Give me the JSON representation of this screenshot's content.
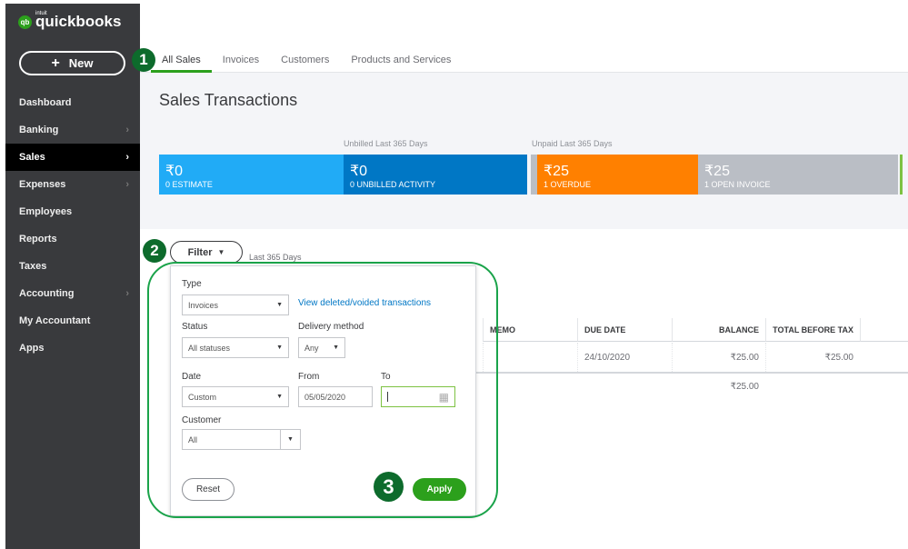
{
  "brand": {
    "logo_small": "intuit",
    "logo": "quickbooks",
    "logo_mark": "qb"
  },
  "sidebar": {
    "new_label": "New",
    "items": [
      {
        "label": "Dashboard",
        "chevron": false
      },
      {
        "label": "Banking",
        "chevron": true
      },
      {
        "label": "Sales",
        "chevron": true,
        "active": true
      },
      {
        "label": "Expenses",
        "chevron": true
      },
      {
        "label": "Employees",
        "chevron": false
      },
      {
        "label": "Reports",
        "chevron": false
      },
      {
        "label": "Taxes",
        "chevron": false
      },
      {
        "label": "Accounting",
        "chevron": true
      },
      {
        "label": "My Accountant",
        "chevron": false
      },
      {
        "label": "Apps",
        "chevron": false
      }
    ]
  },
  "tabs": [
    "All Sales",
    "Invoices",
    "Customers",
    "Products and Services"
  ],
  "page_title": "Sales Transactions",
  "summary": {
    "unbilled_caption": "Unbilled Last 365 Days",
    "unpaid_caption": "Unpaid Last 365 Days",
    "cards": [
      {
        "amount": "₹0",
        "label": "0 ESTIMATE",
        "color": "#21abf6"
      },
      {
        "amount": "₹0",
        "label": "0 UNBILLED ACTIVITY",
        "color": "#0077c5"
      },
      {
        "amount": "₹25",
        "label": "1 OVERDUE",
        "color": "#ff8000"
      },
      {
        "amount": "₹25",
        "label": "1 OPEN INVOICE",
        "color": "#babec5"
      }
    ]
  },
  "badges": [
    "1",
    "2",
    "3"
  ],
  "filter": {
    "button": "Filter",
    "range": "Last 365 Days",
    "type_label": "Type",
    "type_value": "Invoices",
    "view_deleted": "View deleted/voided transactions",
    "status_label": "Status",
    "status_value": "All statuses",
    "delivery_label": "Delivery method",
    "delivery_value": "Any",
    "date_label": "Date",
    "date_value": "Custom",
    "from_label": "From",
    "from_value": "05/05/2020",
    "to_label": "To",
    "to_value": "",
    "customer_label": "Customer",
    "customer_value": "All",
    "reset": "Reset",
    "apply": "Apply"
  },
  "table": {
    "headers": [
      "MEMO",
      "DUE DATE",
      "BALANCE",
      "TOTAL BEFORE TAX"
    ],
    "row": [
      "",
      "24/10/2020",
      "₹25.00",
      "₹25.00"
    ],
    "total_balance": "₹25.00"
  },
  "colors": {
    "accent": "#2ca01c",
    "sidebar": "#393a3d",
    "annotation": "#1aa34a"
  }
}
